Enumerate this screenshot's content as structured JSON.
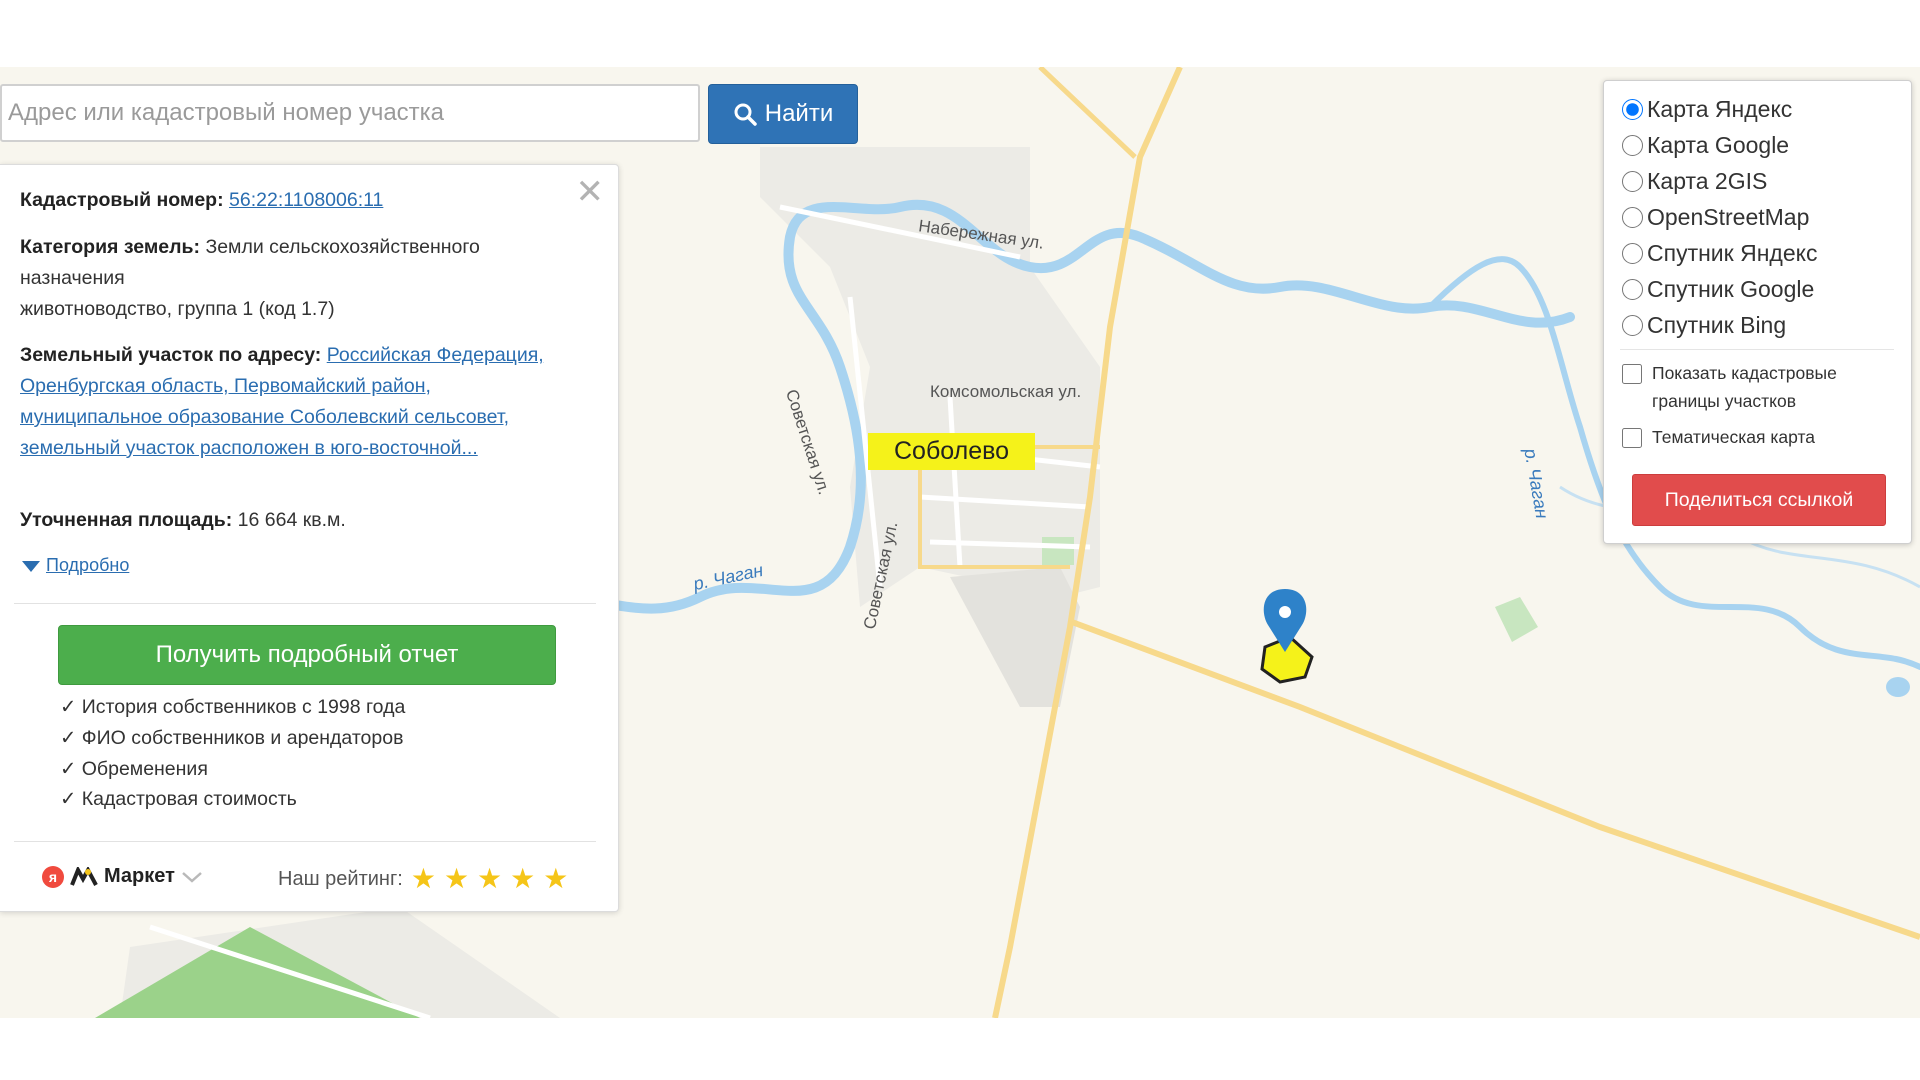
{
  "search": {
    "placeholder": "Адрес или кадастровый номер участка",
    "button_label": "Найти",
    "icon": "search-icon"
  },
  "info": {
    "cadastral_label": "Кадастровый номер:",
    "cadastral_value": "56:22:1108006:11",
    "category_label": "Категория земель:",
    "category_value": "Земли сельскохозяйственного назначения",
    "usage": "животноводство, группа 1 (код 1.7)",
    "address_label": "Земельный участок по адресу:",
    "address_value": "Российская Федерация, Оренбургская область, Первомайский район, муниципальное образование Соболевский сельсовет, земельный участок расположен в юго-восточной...",
    "area_label": "Уточненная площадь:",
    "area_value": "16 664 кв.м.",
    "details_label": "Подробно",
    "report_button": "Получить подробный отчет",
    "features": [
      "История собственников с 1998 года",
      "ФИО собственников и арендаторов",
      "Обременения",
      "Кадастровая стоимость"
    ],
    "check_mark": "✓",
    "market_badge": "я",
    "market_label": "Маркет",
    "rating_label": "Наш рейтинг:",
    "rating_stars": 5,
    "close_symbol": "✕"
  },
  "layers": {
    "map_options": [
      "Карта Яндекс",
      "Карта Google",
      "Карта 2GIS",
      "OpenStreetMap",
      "Спутник Яндекс",
      "Спутник Google",
      "Спутник Bing"
    ],
    "selected": "Карта Яндекс",
    "show_cadastral_label": "Показать кадастровые границы участков",
    "thematic_label": "Тематическая карта",
    "share_button": "Поделиться ссылкой"
  },
  "map": {
    "town_name": "Соболево",
    "streets": {
      "naberezhnaya": "Набережная ул.",
      "sovetskaya": "Советская ул.",
      "komsomolskaya": "Комсомольская ул."
    },
    "river_names": {
      "left": "р. Чаган",
      "right": "р. Чаган"
    },
    "colors": {
      "road": "#f7d98b",
      "river": "#a8d3f0",
      "marker": "#2e82c9",
      "parcel": "#f5f21a",
      "search_button": "#2f73b6",
      "report_button": "#4cae4c",
      "share_button": "#e14c4c"
    }
  }
}
